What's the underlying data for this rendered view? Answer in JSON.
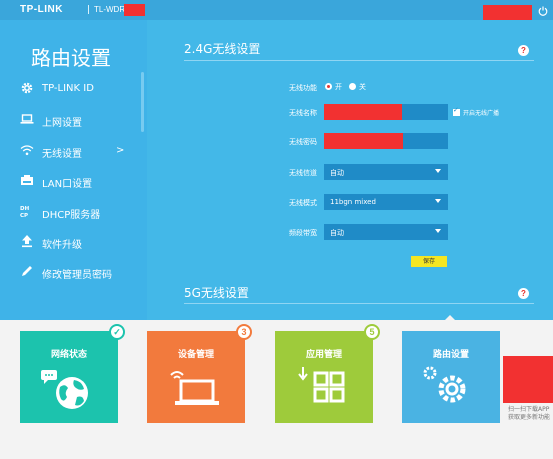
{
  "header": {
    "logo": "TP-LINK",
    "model": "TL-WDR"
  },
  "sidebar": {
    "title": "路由设置",
    "items": [
      {
        "label": "TP-LINK ID",
        "icon": "gear-icon"
      },
      {
        "label": "上网设置",
        "icon": "laptop-icon"
      },
      {
        "label": "无线设置",
        "icon": "wifi-icon",
        "arrow": ">"
      },
      {
        "label": "LAN口设置",
        "icon": "lan-port-icon"
      },
      {
        "label": "DHCP服务器",
        "icon": "dhcp-icon"
      },
      {
        "label": "软件升级",
        "icon": "upload-icon"
      },
      {
        "label": "修改管理员密码",
        "icon": "pencil-icon"
      }
    ]
  },
  "wireless24": {
    "title": "2.4G无线设置",
    "help": "?",
    "fields": {
      "function_label": "无线功能",
      "on_label": "开",
      "off_label": "关",
      "name_label": "无线名称",
      "broadcast_label": "开启无线广播",
      "password_label": "无线密码",
      "channel_label": "无线信道",
      "channel_value": "自动",
      "mode_label": "无线模式",
      "mode_value": "11bgn mixed",
      "bandwidth_label": "频段带宽",
      "bandwidth_value": "自动"
    },
    "save_label": "保存"
  },
  "wireless5": {
    "title": "5G无线设置",
    "help": "?"
  },
  "tiles": [
    {
      "label": "网络状态",
      "badge": "✓",
      "color": "#1cc3ad"
    },
    {
      "label": "设备管理",
      "badge": "3",
      "color": "#f27a3d"
    },
    {
      "label": "应用管理",
      "badge": "5",
      "color": "#9ecb3b"
    },
    {
      "label": "路由设置",
      "badge": "",
      "color": "#4ab3e3"
    }
  ],
  "qr": {
    "text": "扫一扫下载APP获取更多新功能"
  }
}
